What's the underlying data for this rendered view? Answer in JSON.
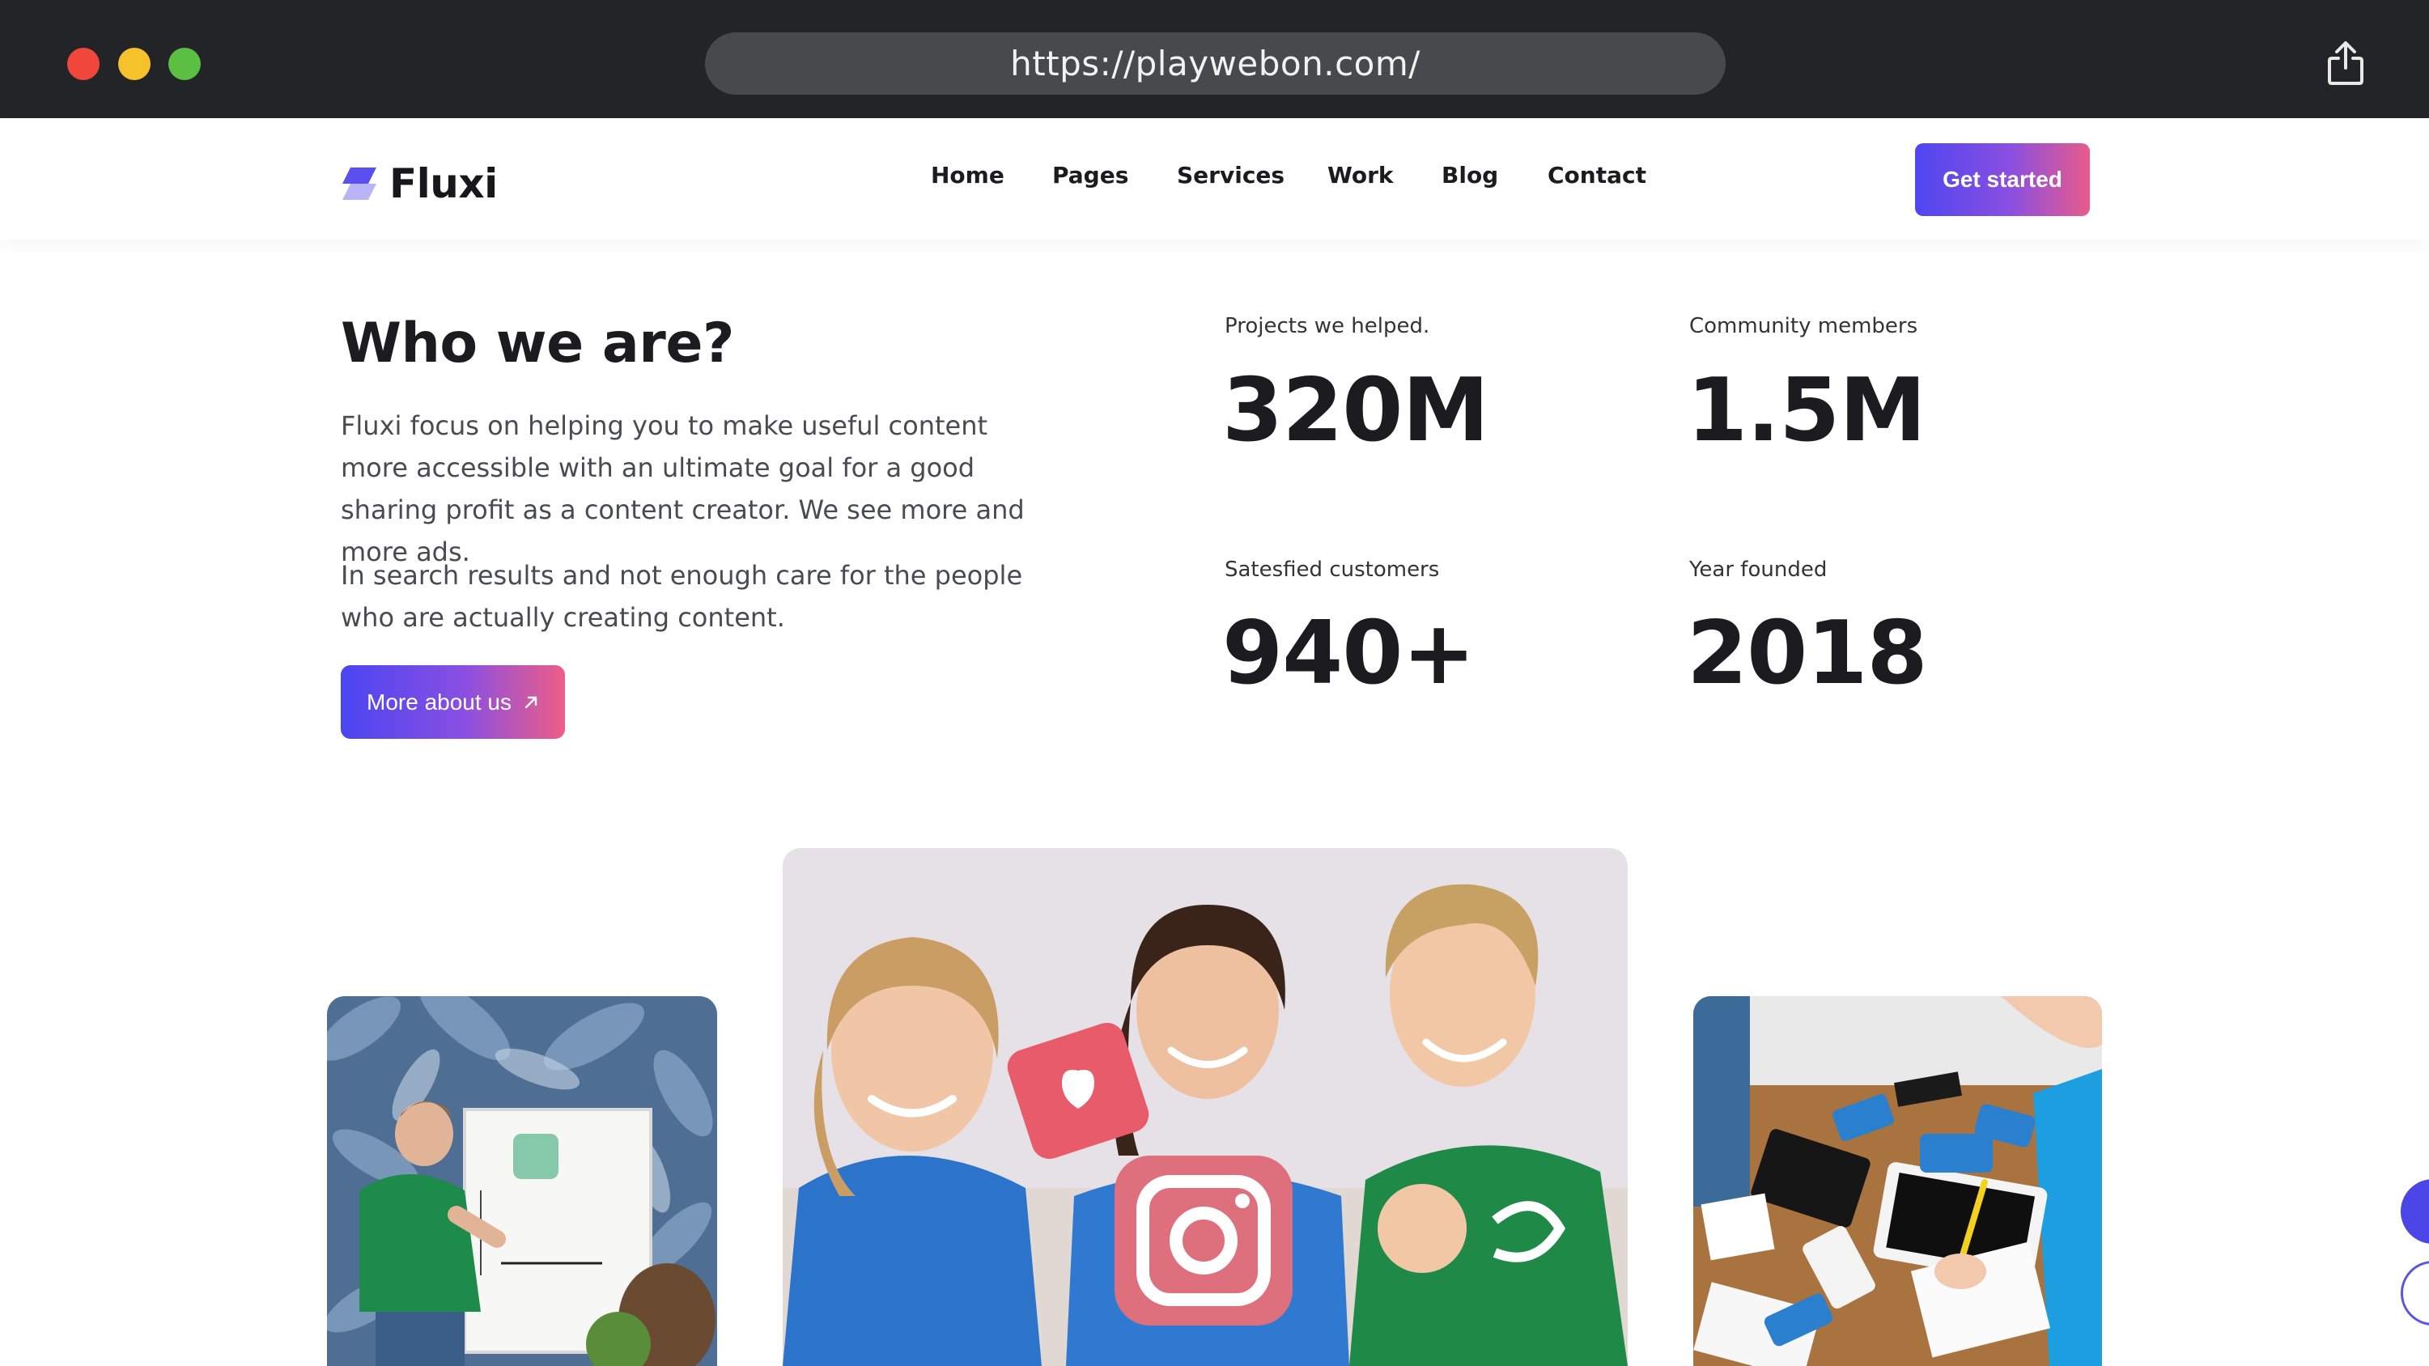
{
  "browser": {
    "url": "https://playwebon.com/"
  },
  "nav": {
    "brand": "Fluxi",
    "items": [
      "Home",
      "Pages",
      "Services",
      "Work",
      "Blog",
      "Contact"
    ],
    "cta": "Get started"
  },
  "about": {
    "heading": "Who we are?",
    "paragraph1": "Fluxi focus on helping you to make useful content more accessible with an ultimate goal for a good sharing profit as a content creator. We see more and more ads.",
    "paragraph2": "In search results and not enough care for the people who are actually creating content.",
    "button": "More about us"
  },
  "stats": [
    {
      "label": "Projects we helped.",
      "value": "320M"
    },
    {
      "label": "Community members",
      "value": "1.5M"
    },
    {
      "label": "Satesfied customers",
      "value": "940+"
    },
    {
      "label": "Year founded",
      "value": "2018"
    }
  ],
  "colors": {
    "accent_start": "#4f46f0",
    "accent_end": "#e85b8a",
    "chrome_bg": "#232427"
  },
  "icons": {
    "share": "share-icon",
    "arrow": "arrow-up-right-icon"
  }
}
